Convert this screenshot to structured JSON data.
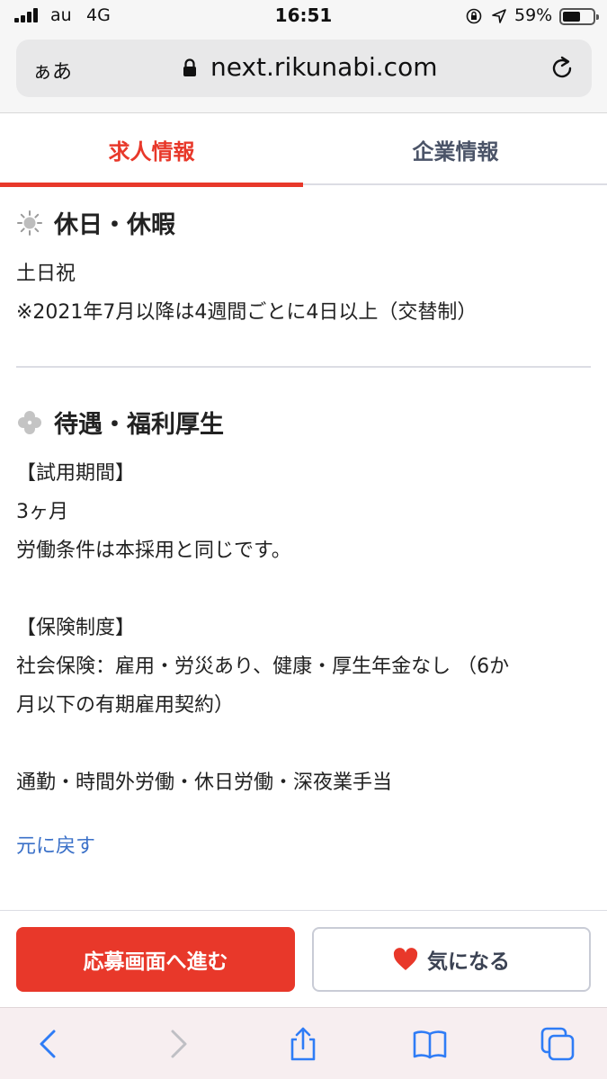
{
  "status_bar": {
    "carrier": "au",
    "network": "4G",
    "time": "16:51",
    "battery_percent": "59%",
    "battery_level": 0.59
  },
  "address_bar": {
    "text_size_label": "ぁあ",
    "url": "next.rikunabi.com"
  },
  "tabs": [
    {
      "label": "求人情報",
      "active": true
    },
    {
      "label": "企業情報",
      "active": false
    }
  ],
  "sections": {
    "holidays": {
      "title": "休日・休暇",
      "icon": "sun-icon",
      "lines": [
        "土日祝",
        "※2021年7月以降は4週間ごとに4日以上（交替制）"
      ]
    },
    "benefits": {
      "title": "待遇・福利厚生",
      "icon": "clover-icon",
      "lines": [
        "【試用期間】",
        "3ヶ月",
        "労働条件は本採用と同じです。",
        "",
        "【保険制度】",
        "社会保険：雇用・労災あり、健康・厚生年金なし （6か",
        "月以下の有期雇用契約）",
        "",
        "通勤・時間外労働・休日労働・深夜業手当"
      ]
    }
  },
  "back_link": "元に戻す",
  "actions": {
    "apply_label": "応募画面へ進む",
    "favorite_label": "気になる"
  },
  "colors": {
    "accent": "#e8382a",
    "link": "#3a70c8",
    "safari_blue": "#2f7cf6"
  },
  "toolbar": {
    "icons": [
      "back-arrow-icon",
      "forward-arrow-icon",
      "share-icon",
      "bookmarks-icon",
      "tabs-icon"
    ]
  }
}
